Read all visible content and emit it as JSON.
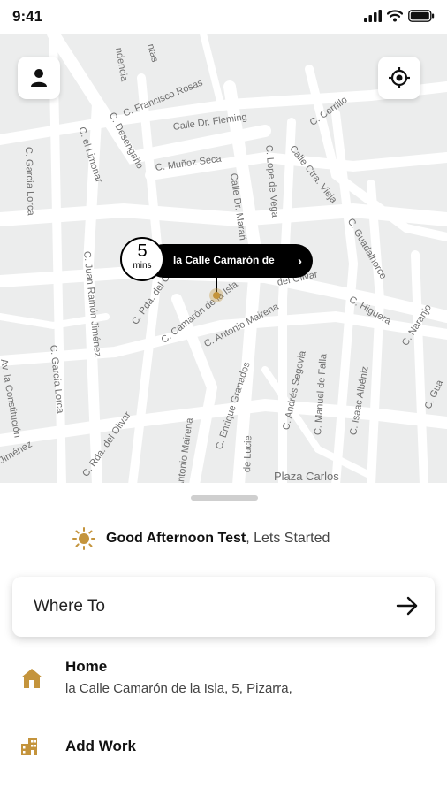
{
  "status_bar": {
    "time": "9:41"
  },
  "map": {
    "streets": [
      "C. Francisco Rosas",
      "Calle Dr. Fleming",
      "C. Muñoz Seca",
      "C. Cerrillo",
      "Calle Ctra. Vieja",
      "C. García Lorca",
      "C. el Limonar",
      "C. Desengaño",
      "Calle Dr. Marañ",
      "C. Lope de Vega",
      "C. Guadalhorce",
      "C. Juan Ramón Jiménez",
      "C. Rda. del Olivar",
      "C. Camarón de la Isla",
      "del Olivar",
      "C. Antonio Mairena",
      "C. Higuera",
      "C. Naranjo",
      "C. García Lorca",
      "Av. la Constitución",
      "Jiménez",
      "C. Rda. del Olivar",
      "C. Enrique Granados",
      "Antonio Mairena",
      "de Lucie",
      "C. Andrés Segovia",
      "C. Manuel de Falla",
      "C. Isaac Albéniz",
      "C. Gua",
      "Plaza Carlos",
      "ndencia",
      "ntas"
    ],
    "eta": {
      "value": "5",
      "unit": "mins"
    },
    "pickup_label": "la Calle Camarón de",
    "chevron": "›"
  },
  "sheet": {
    "greeting_name": "Good Afternoon Test",
    "greeting_rest": ", Lets Started",
    "where_to": "Where To",
    "places": [
      {
        "title": "Home",
        "subtitle": "la Calle Camarón de la Isla, 5, Pizarra,"
      },
      {
        "title": "Add Work"
      }
    ]
  },
  "colors": {
    "accent": "#c4943c",
    "map_bg": "#eceded",
    "road": "#ffffff"
  }
}
